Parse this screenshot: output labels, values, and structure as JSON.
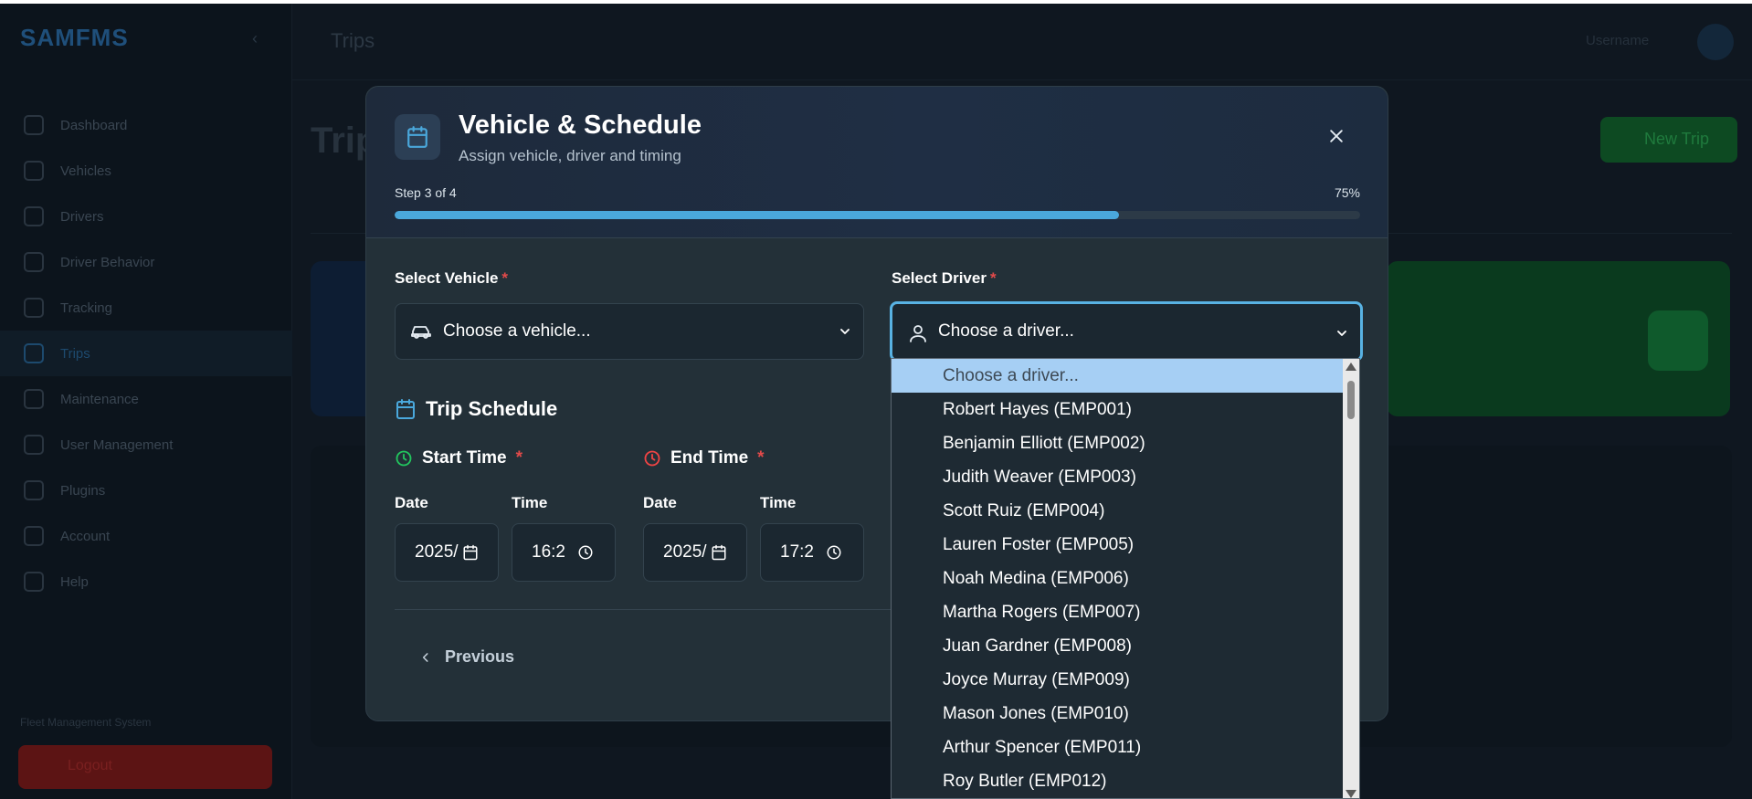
{
  "background": {
    "app_name": "SAMFMS",
    "page_title": "Trips",
    "bg_heading": "Trip",
    "user_name": "Username",
    "new_trip_label": "New Trip",
    "sidebar_items": [
      {
        "label": "Dashboard",
        "active": false
      },
      {
        "label": "Vehicles",
        "active": false
      },
      {
        "label": "Drivers",
        "active": false
      },
      {
        "label": "Driver Behavior",
        "active": false
      },
      {
        "label": "Tracking",
        "active": false
      },
      {
        "label": "Trips",
        "active": true
      },
      {
        "label": "Maintenance",
        "active": false
      },
      {
        "label": "User Management",
        "active": false
      },
      {
        "label": "Plugins",
        "active": false
      },
      {
        "label": "Account",
        "active": false
      },
      {
        "label": "Help",
        "active": false
      }
    ],
    "sidebar_footer": "Fleet Management System",
    "logout_label": "Logout"
  },
  "modal": {
    "title": "Vehicle & Schedule",
    "subtitle": "Assign vehicle, driver and timing",
    "step_text": "Step 3 of 4",
    "progress_text": "75%",
    "progress": 0.75,
    "vehicle": {
      "label": "Select Vehicle",
      "required_mark": "*",
      "value": "Choose a vehicle..."
    },
    "driver": {
      "label": "Select Driver",
      "required_mark": "*",
      "value": "Choose a driver..."
    },
    "schedule": {
      "title": "Trip Schedule",
      "start": {
        "label": "Start Time",
        "required_mark": "*",
        "date_label": "Date",
        "time_label": "Time",
        "date_value": "2025/",
        "time_value": "16:2"
      },
      "end": {
        "label": "End Time",
        "required_mark": "*",
        "date_label": "Date",
        "time_label": "Time",
        "date_value": "2025/",
        "time_value": "17:2"
      }
    },
    "previous_label": "Previous"
  },
  "driver_dropdown": {
    "options": [
      "Choose a driver...",
      "Robert Hayes (EMP001)",
      "Benjamin Elliott (EMP002)",
      "Judith Weaver (EMP003)",
      "Scott Ruiz (EMP004)",
      "Lauren Foster (EMP005)",
      "Noah Medina (EMP006)",
      "Martha Rogers (EMP007)",
      "Juan Gardner (EMP008)",
      "Joyce Murray (EMP009)",
      "Mason Jones (EMP010)",
      "Arthur Spencer (EMP011)",
      "Roy Butler (EMP012)"
    ],
    "selected_index": 0
  },
  "colors": {
    "accent": "#4aa8dc",
    "required": "#e24a4a",
    "start_icon": "#22c55e",
    "end_icon": "#ef4444",
    "selected_option": "#a6cff4"
  }
}
